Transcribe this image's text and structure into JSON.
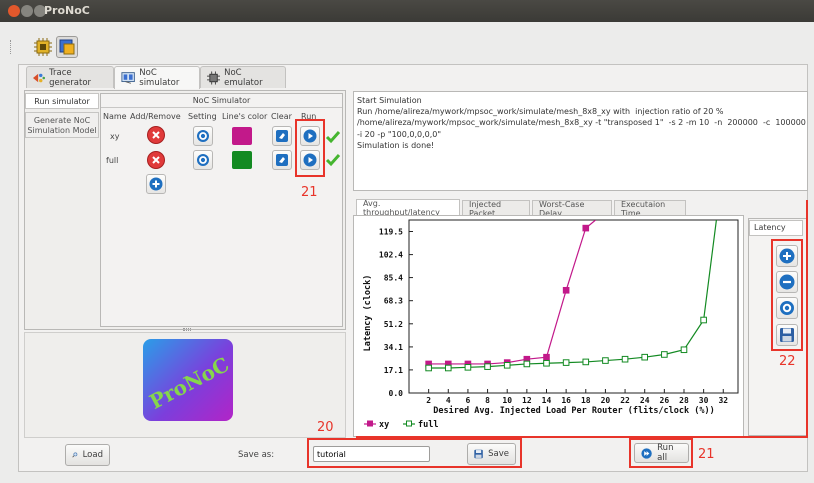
{
  "window": {
    "title": "ProNoC"
  },
  "main_tabs": [
    {
      "label": "Trace generator"
    },
    {
      "label": "NoC simulator"
    },
    {
      "label": "NoC emulator"
    }
  ],
  "side_tabs": [
    {
      "label": "Run simulator"
    },
    {
      "label": "Generate NoC Simulation Model"
    }
  ],
  "simulator": {
    "title": "NoC Simulator",
    "columns": [
      "Name",
      "Add/Remove",
      "Setting",
      "Line's color",
      "Clear",
      "Run"
    ],
    "rows": [
      {
        "name": "xy",
        "color": "#c2198a"
      },
      {
        "name": "full",
        "color": "#138a22"
      }
    ]
  },
  "logo": {
    "text": "ProNoC"
  },
  "log": {
    "lines": [
      "Start Simulation",
      "Run /home/alireza/mywork/mpsoc_work/simulate/mesh_8x8_xy with  injection ratio of 20 %",
      "/home/alireza/mywork/mpsoc_work/simulate/mesh_8x8_xy -t \"transposed 1\"  -s 2 -m 10  -n  200000  -c  100000",
      "-i 20 -p \"100,0,0,0,0\"",
      "Simulation is done!"
    ]
  },
  "plot_tabs": [
    {
      "label": "Avg. throughput/latency"
    },
    {
      "label": "Injected Packet"
    },
    {
      "label": "Worst-Case Delay"
    },
    {
      "label": "Execution Time",
      "display": "Executaion Time"
    }
  ],
  "latency_panel": {
    "label": "Latency"
  },
  "annotations": {
    "n20": "20",
    "n21a": "21",
    "n21b": "21",
    "n22": "22"
  },
  "bottom": {
    "load_label": "Load",
    "save_as_label": "Save as:",
    "save_as_value": "tutorial",
    "save_label": "Save",
    "run_all_label": "Run all"
  },
  "chart_data": {
    "type": "line",
    "xlabel": "Desired Avg. Injected Load Per Router (flits/clock (%))",
    "ylabel": "Latency (clock)",
    "xticks": [
      2,
      4,
      6,
      8,
      10,
      12,
      14,
      16,
      18,
      20,
      22,
      24,
      26,
      28,
      30,
      32
    ],
    "yticks": [
      "0.0",
      "17.1",
      "34.1",
      "51.2",
      "68.3",
      "85.4",
      "102.4",
      "119.5"
    ],
    "xlim": [
      0,
      33.5
    ],
    "ylim": [
      0,
      128
    ],
    "legend": "bottom-left",
    "series": [
      {
        "name": "xy",
        "color": "#c2198a",
        "marker": "square-filled",
        "x": [
          2,
          4,
          6,
          8,
          10,
          12,
          14,
          16,
          18,
          19
        ],
        "y": [
          21.5,
          21.5,
          21.5,
          21.5,
          22.5,
          25,
          26.5,
          76,
          122,
          128
        ]
      },
      {
        "name": "full",
        "color": "#138a22",
        "marker": "square-open",
        "x": [
          2,
          4,
          6,
          8,
          10,
          12,
          14,
          16,
          18,
          20,
          22,
          24,
          26,
          28,
          30,
          31.3
        ],
        "y": [
          18.5,
          18.5,
          19,
          19.5,
          20.5,
          21.5,
          22,
          22.5,
          23,
          24,
          25,
          26.5,
          28.5,
          32,
          54,
          128
        ]
      }
    ]
  }
}
